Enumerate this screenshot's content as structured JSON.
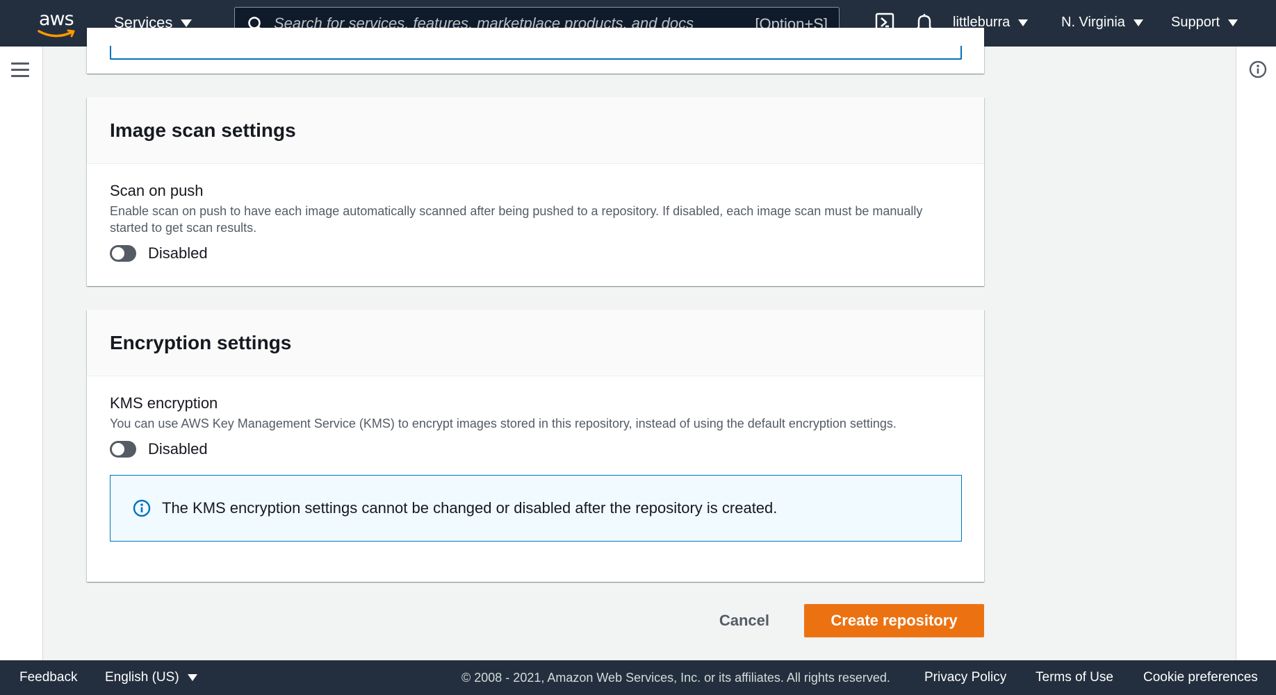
{
  "topnav": {
    "logo_text": "aws",
    "services_label": "Services",
    "search_placeholder": "Search for services, features, marketplace products, and docs",
    "search_shortcut": "[Option+S]",
    "account_label": "littleburra",
    "region_label": "N. Virginia",
    "support_label": "Support",
    "icons": [
      "cloudshell-icon",
      "bell-icon"
    ]
  },
  "image_scan": {
    "title": "Image scan settings",
    "field_label": "Scan on push",
    "field_description": "Enable scan on push to have each image automatically scanned after being pushed to a repository. If disabled, each image scan must be manually started to get scan results.",
    "toggle_state": "Disabled"
  },
  "encryption": {
    "title": "Encryption settings",
    "field_label": "KMS encryption",
    "field_description": "You can use AWS Key Management Service (KMS) to encrypt images stored in this repository, instead of using the default encryption settings.",
    "toggle_state": "Disabled",
    "alert_text": "The KMS encryption settings cannot be changed or disabled after the repository is created."
  },
  "actions": {
    "cancel_label": "Cancel",
    "create_label": "Create repository"
  },
  "footer": {
    "feedback_label": "Feedback",
    "language_label": "English (US)",
    "copyright": "© 2008 - 2021, Amazon Web Services, Inc. or its affiliates. All rights reserved.",
    "privacy_label": "Privacy Policy",
    "terms_label": "Terms of Use",
    "cookie_label": "Cookie preferences"
  },
  "colors": {
    "nav_bg": "#232f3e",
    "primary_button": "#ec7211",
    "info_blue": "#0073bb",
    "toggle_off": "#545b64"
  }
}
